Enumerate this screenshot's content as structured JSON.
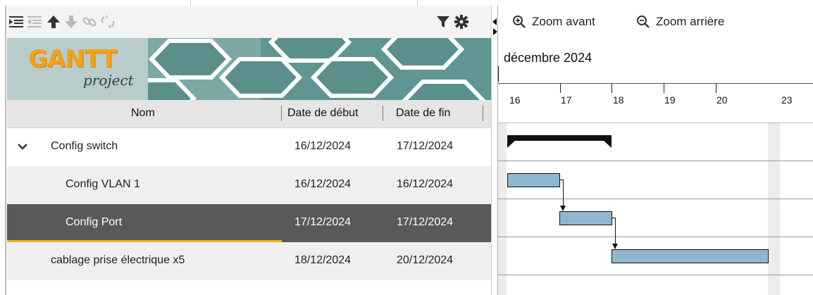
{
  "toolbar": {
    "icons": [
      "indent-icon",
      "outdent-icon",
      "move-up-icon",
      "move-down-icon",
      "link-icon",
      "unlink-icon",
      "filter-icon",
      "gear-icon"
    ]
  },
  "banner": {
    "logo_text": "GANTT",
    "logo_sub": "project"
  },
  "table": {
    "headers": {
      "name": "Nom",
      "start": "Date de début",
      "end": "Date de fin"
    },
    "rows": [
      {
        "name": "Config switch",
        "start": "16/12/2024",
        "end": "17/12/2024",
        "level": 0,
        "expanded": true
      },
      {
        "name": "Config VLAN 1",
        "start": "16/12/2024",
        "end": "16/12/2024",
        "level": 1
      },
      {
        "name": "Config Port",
        "start": "17/12/2024",
        "end": "17/12/2024",
        "level": 1,
        "selected": true
      },
      {
        "name": "cablage prise électrique x5",
        "start": "18/12/2024",
        "end": "20/12/2024",
        "level": 0
      }
    ]
  },
  "chart": {
    "zoom_in": "Zoom avant",
    "zoom_out": "Zoom arrière",
    "month": "décembre 2024",
    "days": [
      "16",
      "17",
      "18",
      "19",
      "20",
      "23"
    ]
  },
  "colors": {
    "task_bar": "#8fb7cf",
    "selected_row": "#595959",
    "selection_accent": "#f0b41c",
    "logo": "#f0a21a"
  }
}
